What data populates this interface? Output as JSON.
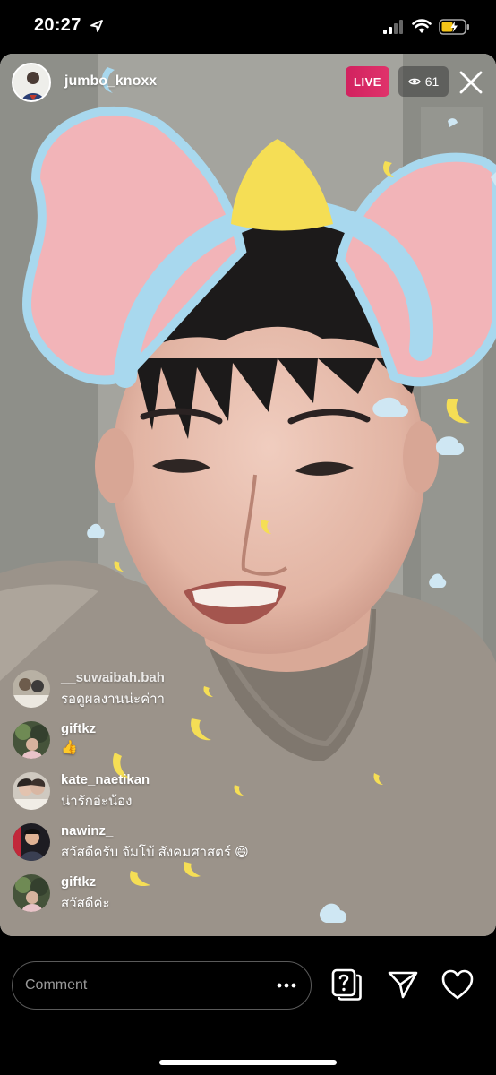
{
  "status_bar": {
    "time": "20:27"
  },
  "header": {
    "host_username": "jumbo_knoxx",
    "live_label": "LIVE",
    "viewer_count": "61"
  },
  "comments": [
    {
      "username": "__suwaibah.bah",
      "text": "รอดูผลงานน่ะค่าา"
    },
    {
      "username": "giftkz",
      "text": "👍"
    },
    {
      "username": "kate_naetikan",
      "text": "น่ารักอ่ะน้อง"
    },
    {
      "username": "nawinz_",
      "text": "สวัสดีครับ จัมโบ้ สังคมศาสตร์ 😄"
    },
    {
      "username": "giftkz",
      "text": "สวัสดีค่ะ"
    }
  ],
  "composer": {
    "placeholder": "Comment"
  },
  "colors": {
    "live_badge": "#d1225f",
    "bow_pink": "#f2b4b8",
    "headband_blue": "#a8d8ee",
    "bell_yellow": "#f5de55"
  },
  "icons": [
    "location-arrow-icon",
    "signal-icon",
    "wifi-icon",
    "battery-charging-icon",
    "eye-icon",
    "close-icon",
    "more-dots-icon",
    "question-sticker-icon",
    "send-icon",
    "heart-icon"
  ]
}
